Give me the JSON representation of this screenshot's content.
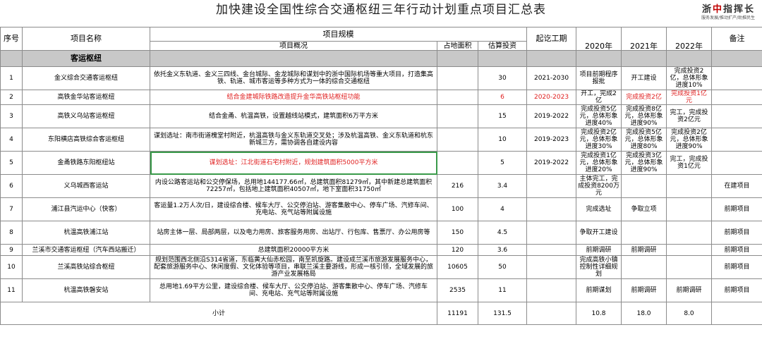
{
  "title": "加快建设全国性综合交通枢纽三年行动计划重点项目汇总表",
  "logo": {
    "left": "浙",
    "mid": "中",
    "right": "指挥长",
    "tag": "服务发展/推动扩产/助推民生"
  },
  "headers": {
    "seq": "序号",
    "name": "项目名称",
    "scale": "项目规模",
    "overview": "项目概况",
    "area": "占地面积",
    "invest": "估算投资",
    "period": "起讫工期",
    "y2020": "2020年",
    "y2021": "2021年",
    "y2022": "2022年",
    "note": "备注"
  },
  "section": "客运枢纽",
  "rows": [
    {
      "seq": "1",
      "name": "金义综合交通客运枢纽",
      "overview": "依托金义东轨道、金义三四线、金台城际、金龙城际和谋划中的浙中国际机场等重大项目，打造集高铁、轨道、城市客运等多种方式为一体的综合交通枢纽",
      "area": "",
      "invest": "30",
      "period": "2021-2030",
      "y2020": "项目前期程序报批",
      "y2021": "开工建设",
      "y2022": "完成投资2亿，总体形象进度10%",
      "note": ""
    },
    {
      "seq": "2",
      "name": "高铁金华站客运枢纽",
      "overview": "结合金建城际铁路改造提升金华高铁站枢纽功能",
      "area": "",
      "invest": "6",
      "period": "2020-2023",
      "y2020": "开工，完成2亿",
      "y2021": "完成投资2亿",
      "y2022": "完成投资1亿元",
      "note": ""
    },
    {
      "seq": "3",
      "name": "高铁义乌站客运枢纽",
      "overview": "结合金甬、杭温高铁，设置越线站模式，建筑面积6万平方米",
      "area": "",
      "invest": "15",
      "period": "2019-2022",
      "y2020": "完成投资5亿元，总体形象进度40%",
      "y2021": "完成投资8亿元，总体形象进度90%",
      "y2022": "完工，完成投资2亿元",
      "note": ""
    },
    {
      "seq": "4",
      "name": "东阳横店高铁综合客运枢纽",
      "overview": "谋划选址：南市街道槐堂村附近，杭温高铁与金义东轨道交叉处；涉及杭温高铁、金义东轨道和杭东新城三方，需协调各自建设内容",
      "area": "",
      "invest": "10",
      "period": "2019-2023",
      "y2020": "完成投资2亿元，总体形象进度30%",
      "y2021": "完成投资5亿元，总体形象进度80%",
      "y2022": "完成投资2亿元，总体形象进度90%",
      "note": ""
    },
    {
      "seq": "5",
      "name": "金甬铁路东阳枢纽站",
      "overview": "谋划选址：江北街道石宅村附近，规划建筑面积5000平方米",
      "area": "",
      "invest": "5",
      "period": "2019-2022",
      "y2020": "完成投资1亿元，总体形象进度20%",
      "y2021": "完成投资3亿元，总体形象进度90%",
      "y2022": "完工，完成投资1亿元",
      "note": ""
    },
    {
      "seq": "6",
      "name": "义乌城西客运站",
      "overview": "内设公路客运站和公交停保场，总用地144177.66㎡，总建筑面积81279㎡，其中新建总建筑面积72257㎡，包括地上建筑面积40507㎡，地下室面积31750㎡",
      "area": "216",
      "invest": "3.4",
      "period": "",
      "y2020": "主体完工，完成投资8200万元",
      "y2021": "",
      "y2022": "",
      "note": "在建项目"
    },
    {
      "seq": "7",
      "name": "浦江县汽运中心（快客）",
      "overview": "客运量1.2万人次/日，建设综合楼、候车大厅、公交停泊站、游客集散中心、停车广场、汽修车间、充电站、充气站等附属设施",
      "area": "100",
      "invest": "4",
      "period": "",
      "y2020": "完成选址",
      "y2021": "争取立项",
      "y2022": "",
      "note": "前期项目"
    },
    {
      "seq": "8",
      "name": "杭温高铁浦江站",
      "overview": "站房主体一层、局部两层，以及电力用房、旅客服务用房、出站厅、行包库、售票厅、办公用房等",
      "area": "150",
      "invest": "4.5",
      "period": "",
      "y2020": "争取开工建设",
      "y2021": "",
      "y2022": "",
      "note": "前期项目"
    },
    {
      "seq": "9",
      "name": "兰溪市交通客运枢纽（汽车西站搬迁）",
      "overview": "总建筑面积20000平方米",
      "area": "120",
      "invest": "3.6",
      "period": "",
      "y2020": "前期调研",
      "y2021": "前期调研",
      "y2022": "",
      "note": "前期项目"
    },
    {
      "seq": "10",
      "name": "兰溪高铁站综合枢纽",
      "overview": "规划范围西北侧沿S314省道，东临黄大仙赤松园，南至凯旋路。建设成兰溪市旅游发展服务中心，配套旅游服务中心、休闲度假、文化体验等项目，串联兰溪主要游线，形成一核引领，全域发展的旅游产业发展格局",
      "area": "10605",
      "invest": "50",
      "period": "",
      "y2020": "完成高铁小镇控制性详细规划",
      "y2021": "",
      "y2022": "",
      "note": "前期项目"
    },
    {
      "seq": "11",
      "name": "杭温高铁磐安站",
      "overview": "总用地1.69平方公里，建设综合楼、候车大厅、公交停泊站、游客集散中心、停车广场、汽修车间、充电站、充气站等附属设施",
      "area": "2535",
      "invest": "11",
      "period": "",
      "y2020": "前期谋划",
      "y2021": "前期调研",
      "y2022": "前期调研",
      "note": "前期项目"
    }
  ],
  "total": {
    "label": "小计",
    "area": "11191",
    "invest": "131.5",
    "y2020": "10.8",
    "y2021": "18.0",
    "y2022": "8.0"
  },
  "colors": {
    "section_bg": "#c8c8c8",
    "highlight_red": "#e02020",
    "highlight_border": "#3a9a4a",
    "grid": "#8c8c8c"
  }
}
